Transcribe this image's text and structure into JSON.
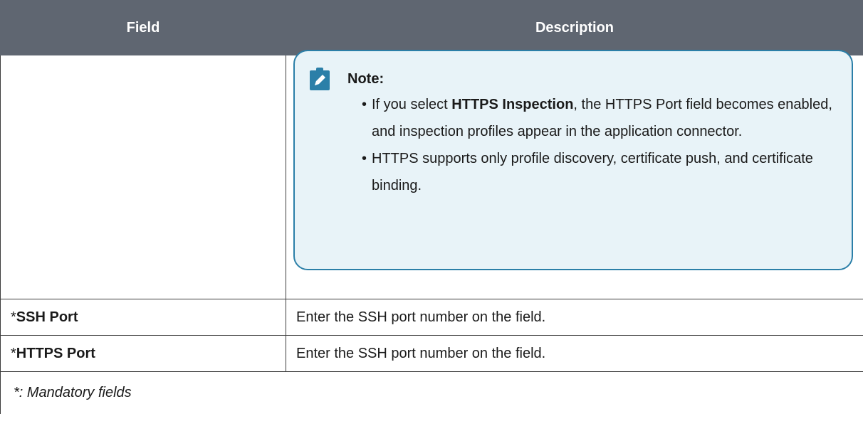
{
  "table": {
    "headers": {
      "field": "Field",
      "description": "Description"
    },
    "note": {
      "title": "Note:",
      "icon": "pencil-clipboard-icon",
      "items": [
        {
          "prefix": "If you select ",
          "bold": "HTTPS Inspection",
          "suffix": ", the HTTPS Port field becomes enabled, and inspection profiles appear in the application connector."
        },
        {
          "prefix": "HTTPS supports only profile discovery, certificate push, and certificate binding.",
          "bold": "",
          "suffix": ""
        }
      ]
    },
    "rows": [
      {
        "star": "*",
        "field": "SSH Port",
        "description": "Enter the SSH port number on the field."
      },
      {
        "star": "*",
        "field": "HTTPS Port",
        "description": "Enter the SSH port number on the field."
      }
    ],
    "footer": "*: Mandatory fields"
  },
  "colors": {
    "header_bg": "#5f6671",
    "note_bg": "#e8f3f8",
    "note_border": "#2b7fa8"
  }
}
